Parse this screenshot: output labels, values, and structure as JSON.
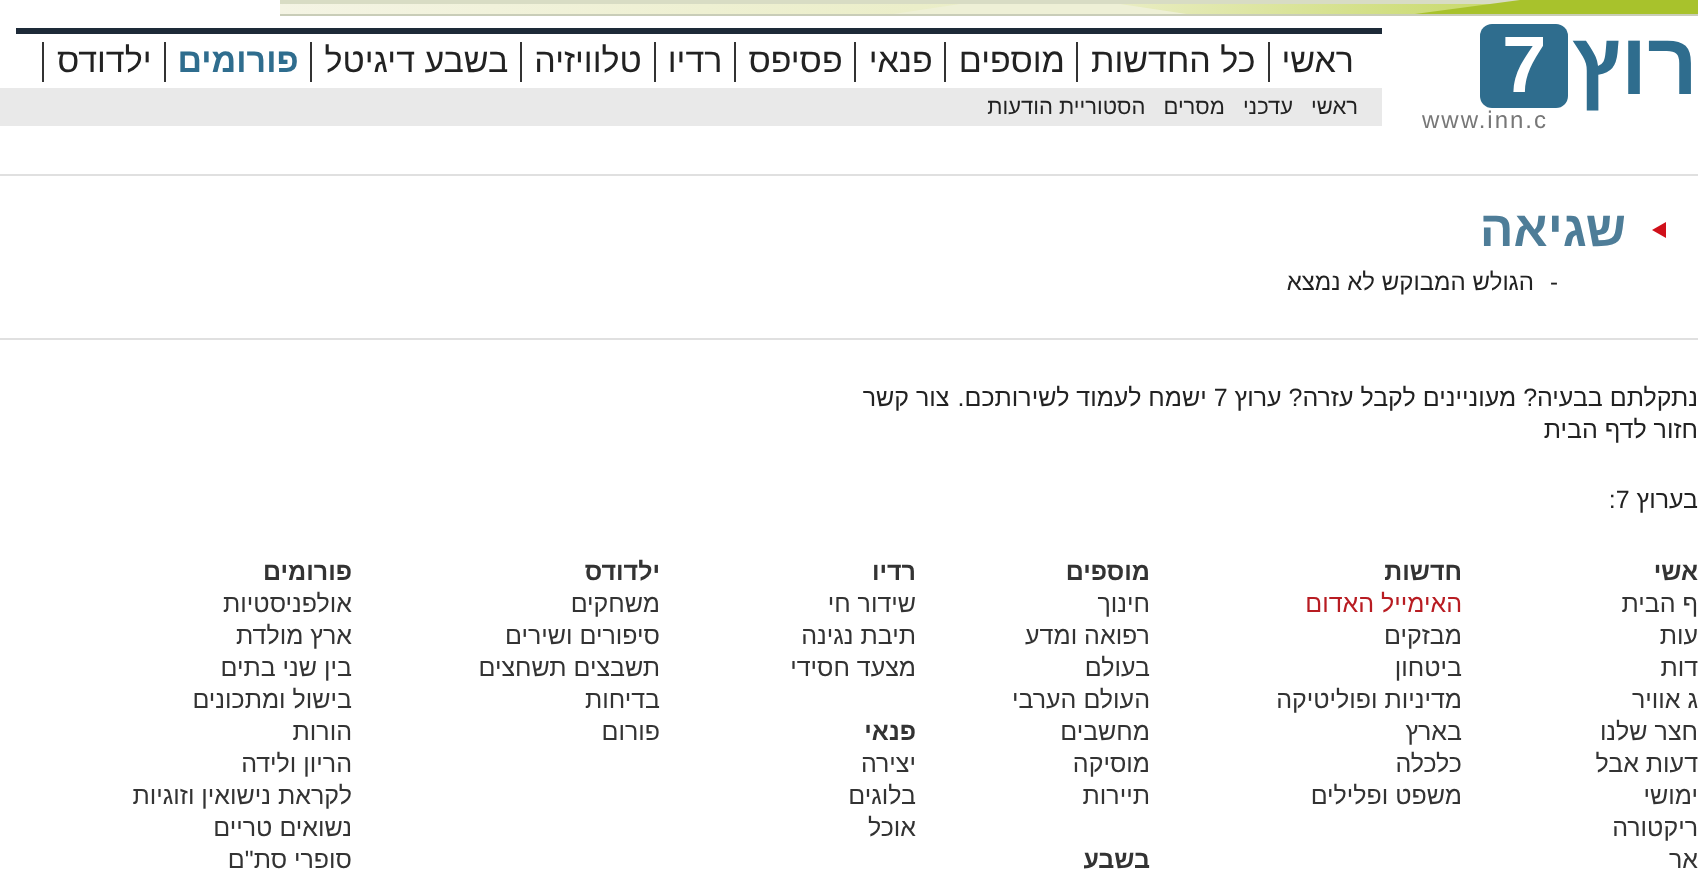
{
  "logo": {
    "name": "רוץ",
    "digit": "7",
    "url": "www.inn.c"
  },
  "nav": [
    {
      "label": "ראשי",
      "selected": false
    },
    {
      "label": "כל החדשות",
      "selected": false
    },
    {
      "label": "מוספים",
      "selected": false
    },
    {
      "label": "פנאי",
      "selected": false
    },
    {
      "label": "פסיפס",
      "selected": false
    },
    {
      "label": "רדיו",
      "selected": false
    },
    {
      "label": "טלוויזיה",
      "selected": false
    },
    {
      "label": "בשבע דיגיטל",
      "selected": false
    },
    {
      "label": "פורומים",
      "selected": true
    },
    {
      "label": "ילדודס",
      "selected": false
    }
  ],
  "subnav": [
    "ראשי",
    "עדכני",
    "מסרים",
    "הסטוריית הודעות"
  ],
  "error": {
    "title": "שגיאה",
    "bullet": "-",
    "message": "הגולש המבוקש לא נמצא"
  },
  "help": {
    "text": "נתקלתם בבעיה? מעוניינים לקבל עזרה? ערוץ 7 ישמח לעמוד לשירותכם.",
    "link": "צור קשר"
  },
  "home_link": "חזור לדף הבית",
  "sitemap_label": "בערוץ 7:",
  "columns": [
    {
      "sections": [
        {
          "heading": "אשי",
          "links": [
            {
              "label": "ף הבית",
              "hot": false
            },
            {
              "label": "עות",
              "hot": false
            },
            {
              "label": "דות",
              "hot": false
            },
            {
              "label": "ג אוויר",
              "hot": false
            },
            {
              "label": "חצר שלנו",
              "hot": false
            },
            {
              "label": "דעות אבל",
              "hot": false
            },
            {
              "label": "ימושי",
              "hot": false
            },
            {
              "label": "ריקטורה",
              "hot": false
            },
            {
              "label": "אר",
              "hot": false
            }
          ]
        }
      ]
    },
    {
      "sections": [
        {
          "heading": "חדשות",
          "links": [
            {
              "label": "האימייל האדום",
              "hot": true
            },
            {
              "label": "מבזקים",
              "hot": false
            },
            {
              "label": "ביטחון",
              "hot": false
            },
            {
              "label": "מדיניות ופוליטיקה",
              "hot": false
            },
            {
              "label": "בארץ",
              "hot": false
            },
            {
              "label": "כלכלה",
              "hot": false
            },
            {
              "label": "משפט ופלילים",
              "hot": false
            }
          ]
        }
      ]
    },
    {
      "sections": [
        {
          "heading": "מוספים",
          "links": [
            {
              "label": "חינוך",
              "hot": false
            },
            {
              "label": "רפואה ומדע",
              "hot": false
            },
            {
              "label": "בעולם",
              "hot": false
            },
            {
              "label": "העולם הערבי",
              "hot": false
            },
            {
              "label": "מחשבים",
              "hot": false
            },
            {
              "label": "מוסיקה",
              "hot": false
            },
            {
              "label": "תיירות",
              "hot": false
            }
          ]
        },
        {
          "heading": "בשבע"
        }
      ]
    },
    {
      "sections": [
        {
          "heading": "רדיו",
          "links": [
            {
              "label": "שידור חי",
              "hot": false
            },
            {
              "label": "תיבת נגינה",
              "hot": false
            },
            {
              "label": "מצעד חסידי",
              "hot": false
            }
          ]
        },
        {
          "heading": "פנאי",
          "links": [
            {
              "label": "יצירה",
              "hot": false
            },
            {
              "label": "בלוגים",
              "hot": false
            },
            {
              "label": "אוכל",
              "hot": false
            }
          ]
        }
      ]
    },
    {
      "sections": [
        {
          "heading": "ילדודס",
          "links": [
            {
              "label": "משחקים",
              "hot": false
            },
            {
              "label": "סיפורים ושירים",
              "hot": false
            },
            {
              "label": "תשבצים תשחצים",
              "hot": false
            },
            {
              "label": "בדיחות",
              "hot": false
            },
            {
              "label": "פורום",
              "hot": false
            }
          ]
        }
      ]
    },
    {
      "sections": [
        {
          "heading": "פורומים",
          "links": [
            {
              "label": "אולפניסטיות",
              "hot": false
            },
            {
              "label": "ארץ מולדת",
              "hot": false
            },
            {
              "label": "בין שני בתים",
              "hot": false
            },
            {
              "label": "בישול ומתכונים",
              "hot": false
            },
            {
              "label": "הורות",
              "hot": false
            },
            {
              "label": "הריון ולידה",
              "hot": false
            },
            {
              "label": "לקראת נישואין וזוגיות",
              "hot": false
            },
            {
              "label": "נשואים טריים",
              "hot": false
            },
            {
              "label": "סופרי סת\"ם",
              "hot": false
            }
          ]
        }
      ]
    }
  ]
}
